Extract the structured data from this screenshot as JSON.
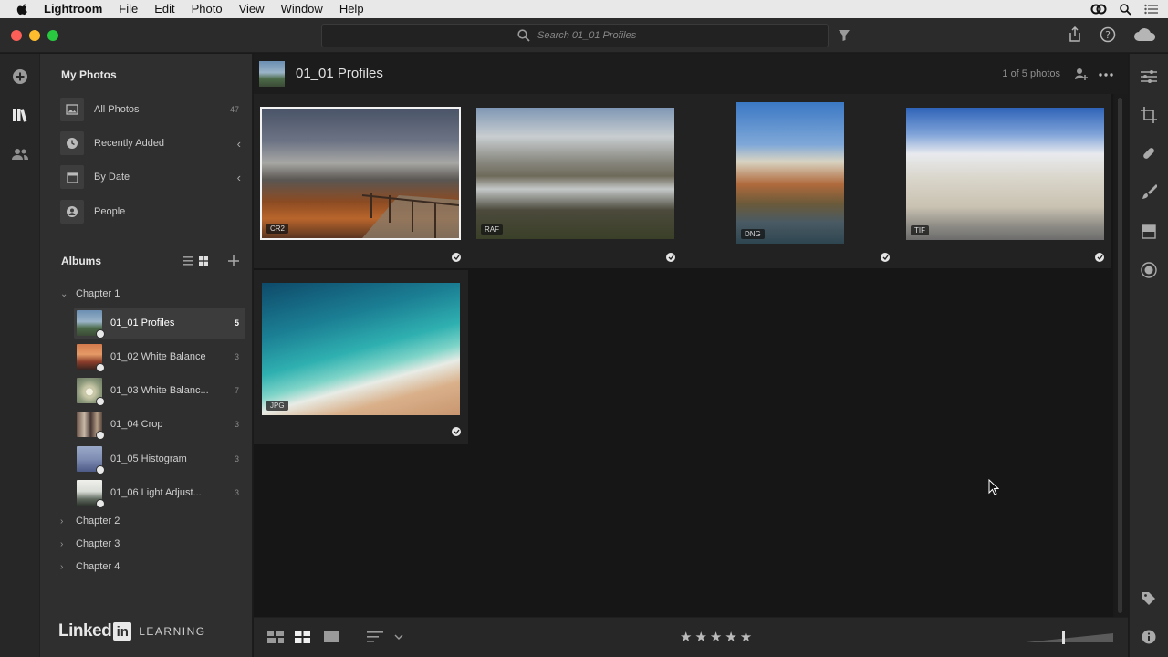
{
  "menubar": {
    "app": "Lightroom",
    "items": [
      "File",
      "Edit",
      "Photo",
      "View",
      "Window",
      "Help"
    ]
  },
  "search": {
    "placeholder": "Search 01_01 Profiles"
  },
  "sidebar": {
    "my_photos": "My Photos",
    "items": [
      {
        "label": "All Photos",
        "count": "47",
        "icon": "photo-icon"
      },
      {
        "label": "Recently Added",
        "chevron": "‹",
        "icon": "clock-icon"
      },
      {
        "label": "By Date",
        "chevron": "‹",
        "icon": "calendar-icon"
      },
      {
        "label": "People",
        "icon": "person-icon"
      }
    ],
    "albums_heading": "Albums",
    "chapter1": "Chapter 1",
    "albums": [
      {
        "label": "01_01 Profiles",
        "count": "5",
        "active": true
      },
      {
        "label": "01_02 White Balance",
        "count": "3"
      },
      {
        "label": "01_03 White Balanc...",
        "count": "7"
      },
      {
        "label": "01_04 Crop",
        "count": "3"
      },
      {
        "label": "01_05 Histogram",
        "count": "3"
      },
      {
        "label": "01_06 Light Adjust...",
        "count": "3"
      }
    ],
    "chapters": [
      "Chapter 2",
      "Chapter 3",
      "Chapter 4"
    ]
  },
  "branding": {
    "linked": "Linked",
    "in": "in",
    "learning": "LEARNING"
  },
  "header": {
    "album_title": "01_01 Profiles",
    "photo_count": "1 of 5 photos"
  },
  "photos": [
    {
      "format": "CR2",
      "subject": "boardwalk-sunset",
      "selected": true
    },
    {
      "format": "RAF",
      "subject": "mountain-clouds"
    },
    {
      "format": "DNG",
      "subject": "palms-building"
    },
    {
      "format": "TIF",
      "subject": "capitol"
    },
    {
      "format": "JPG",
      "subject": "beach"
    }
  ],
  "rating": {
    "stars": "★★★★★"
  },
  "colors": {
    "accent": "#f2f2f2",
    "panel": "#2f2f2f",
    "grid": "#161616"
  }
}
